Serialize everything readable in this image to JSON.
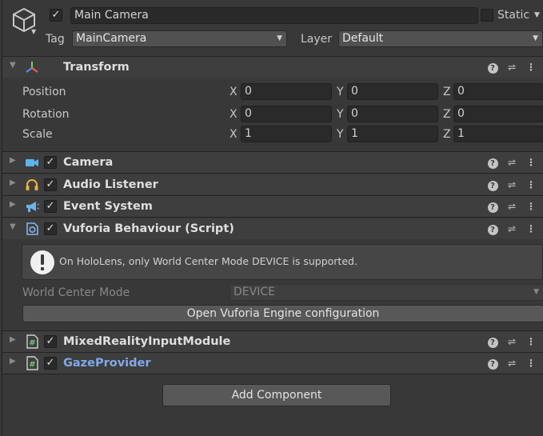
{
  "header": {
    "name": "Main Camera",
    "static_label": "Static",
    "tag_label": "Tag",
    "tag_value": "MainCamera",
    "layer_label": "Layer",
    "layer_value": "Default"
  },
  "transform": {
    "title": "Transform",
    "rows": [
      {
        "label": "Position",
        "x": "0",
        "y": "0",
        "z": "0"
      },
      {
        "label": "Rotation",
        "x": "0",
        "y": "0",
        "z": "0"
      },
      {
        "label": "Scale",
        "x": "1",
        "y": "1",
        "z": "1"
      }
    ],
    "axis_x": "X",
    "axis_y": "Y",
    "axis_z": "Z"
  },
  "components": {
    "camera": "Camera",
    "audio_listener": "Audio Listener",
    "event_system": "Event System",
    "vuforia": "Vuforia Behaviour (Script)",
    "mrtk_input": "MixedRealityInputModule",
    "gaze": "GazeProvider"
  },
  "vuforia": {
    "help_message": "On HoloLens, only World Center Mode DEVICE is supported.",
    "world_center_label": "World Center Mode",
    "world_center_value": "DEVICE",
    "open_config_button": "Open Vuforia Engine configuration"
  },
  "add_component_button": "Add Component",
  "icons": {
    "gameobject": "cube-icon",
    "transform": "transform-axes-icon",
    "camera": "video-camera-icon",
    "audio": "headphones-icon",
    "event": "megaphone-icon",
    "vuforia": "vuforia-script-icon",
    "script": "hash-script-icon",
    "help": "help-icon",
    "preset": "preset-sliders-icon",
    "more": "kebab-menu-icon"
  },
  "colors": {
    "background": "#383838",
    "field": "#2a2a2a",
    "link_title": "#7fa9e8"
  }
}
